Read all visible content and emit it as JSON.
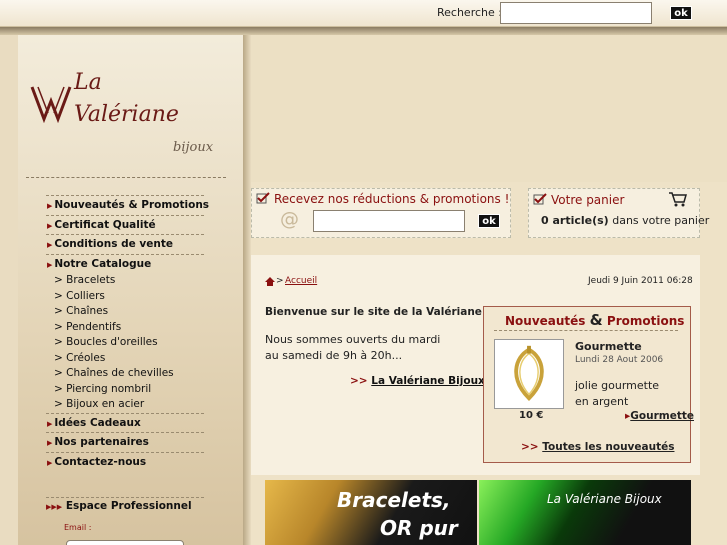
{
  "header": {
    "search_label": "Recherche :",
    "search_value": "",
    "search_ok": "ok"
  },
  "logo": {
    "line1": "La",
    "line2": "Valériane",
    "line3": "bijoux"
  },
  "nav": {
    "items": [
      {
        "label": "Nouveautés & Promotions"
      },
      {
        "label": "Certificat Qualité"
      },
      {
        "label": "Conditions de vente"
      },
      {
        "label": "Notre Catalogue"
      }
    ],
    "catalogue": [
      "> Bracelets",
      "> Colliers",
      "> Chaînes",
      "> Pendentifs",
      "> Boucles d'oreilles",
      "> Créoles",
      "> Chaînes de chevilles",
      "> Piercing nombril",
      "> Bijoux en acier"
    ],
    "items2": [
      {
        "label": "Idées Cadeaux"
      },
      {
        "label": "Nos partenaires"
      },
      {
        "label": "Contactez-nous"
      }
    ]
  },
  "pro": {
    "title": "Espace Professionnel",
    "email_label": "Email :"
  },
  "newsletter": {
    "title": "Recevez nos réductions & promotions !",
    "at": "@",
    "ok": "ok"
  },
  "cart": {
    "title": "Votre panier",
    "count": "0 article(s)",
    "suffix": " dans votre panier"
  },
  "breadcrumb": {
    "sep": ">",
    "home": "Accueil"
  },
  "date": "Jeudi 9 Juin 2011 06:28",
  "welcome": {
    "title": "Bienvenue sur le site de la Valériane",
    "hours": "Nous sommes ouverts du mardi au samedi de 9h à 20h...",
    "link_arrows": ">>",
    "link": "La Valériane Bijoux"
  },
  "promo": {
    "title_a": "Nouveautés",
    "amp": "&",
    "title_b": "Promotions",
    "product": {
      "name": "Gourmette",
      "date": "Lundi 28 Aout 2006",
      "desc": "jolie gourmette en argent",
      "price": "10 €",
      "link": "Gourmette"
    },
    "all_arrows": ">>",
    "all_link": "Toutes les nouveautés"
  },
  "ads": {
    "ad1_line1": "Bracelets,",
    "ad1_line2": "OR pur",
    "ad2": "La Valériane Bijoux"
  },
  "colors": {
    "accent": "#8a1010",
    "bg": "#e9dcc1"
  }
}
